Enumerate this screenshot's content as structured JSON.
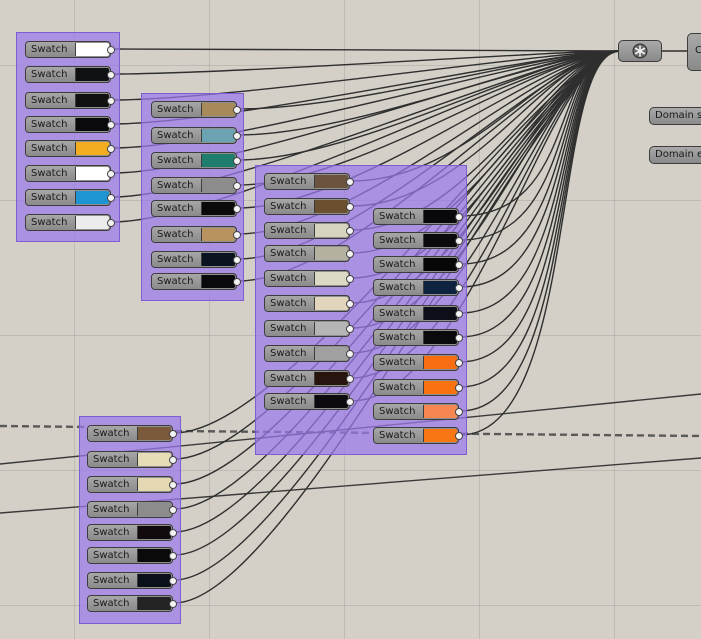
{
  "swatch_label": "Swatch",
  "groups": {
    "a": {
      "colors": [
        "#ffffff",
        "#0f1113",
        "#111111",
        "#0a0a0c",
        "#f4ac20",
        "#ffffff",
        "#1e94d2",
        "#ececec"
      ]
    },
    "b": {
      "colors": [
        "#a8895a",
        "#6ba3b2",
        "#1f7d6d",
        "#8c8c8c",
        "#0a0a0a",
        "#b8925f",
        "#0a1320",
        "#0a0a0c"
      ]
    },
    "c": {
      "colors": [
        "#6b5340",
        "#6b4f31",
        "#d6d3bf",
        "#b4b1a1",
        "#dcd9c5",
        "#e1d5bd",
        "#b5b5b5",
        "#a0a0a0",
        "#28140e",
        "#0d0a10"
      ]
    },
    "d": {
      "colors": [
        "#09090c",
        "#0a0a0e",
        "#070707",
        "#0d2340",
        "#0c0f18",
        "#0a0a0e",
        "#f86d12",
        "#f87310",
        "#f68752",
        "#f87614"
      ]
    },
    "e": {
      "colors": [
        "#7a5a3a",
        "#e6dcb8",
        "#e4d8b2",
        "#8c8c8c",
        "#110b0e",
        "#0a0a0a",
        "#0b0f18",
        "#232323"
      ]
    }
  },
  "components": {
    "right_cut_label": "C",
    "domain_start_label": "Domain st",
    "domain_end_label": "Domain e"
  },
  "icons": {
    "node_icon": "snowflake-icon"
  }
}
